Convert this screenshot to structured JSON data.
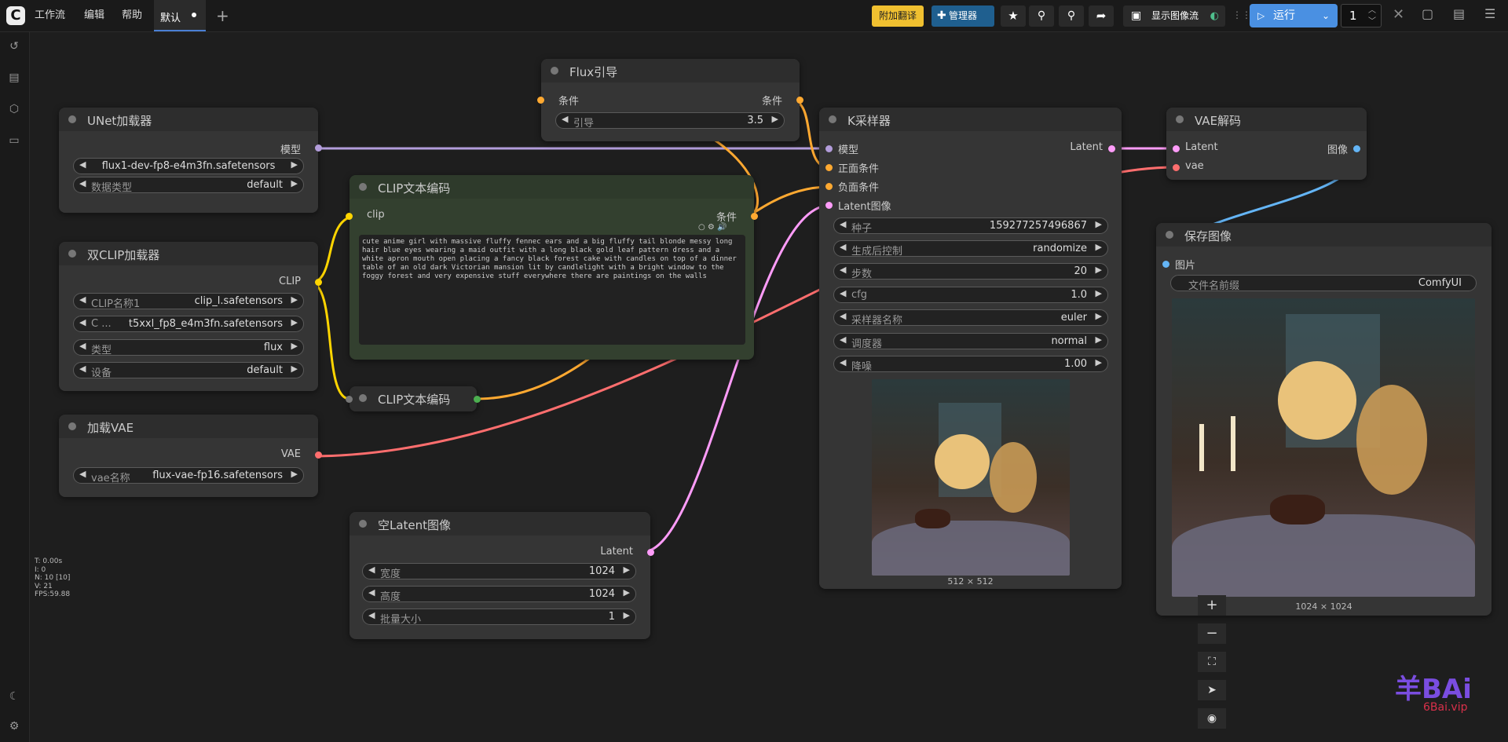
{
  "menu": {
    "workflow": "工作流",
    "edit": "编辑",
    "help": "帮助"
  },
  "tab": {
    "label": "默认"
  },
  "toolbar": {
    "translate": "附加翻译",
    "manager": "管理器",
    "show_flow": "显示图像流",
    "run": "运行",
    "queue_count": "1"
  },
  "nodes": {
    "unet": {
      "title": "UNet加载器",
      "out_model": "模型",
      "unet_name": "flux1-dev-fp8-e4m3fn.safetensors",
      "dtype_label": "数据类型",
      "dtype_value": "default"
    },
    "dualclip": {
      "title": "双CLIP加载器",
      "out_clip": "CLIP",
      "clip1_label": "CLIP名称1",
      "clip1_value": "clip_l.safetensors",
      "clip2_label": "C ...",
      "clip2_value": "t5xxl_fp8_e4m3fn.safetensors",
      "type_label": "类型",
      "type_value": "flux",
      "device_label": "设备",
      "device_value": "default"
    },
    "vae_loader": {
      "title": "加载VAE",
      "out_vae": "VAE",
      "vae_label": "vae名称",
      "vae_value": "flux-vae-fp16.safetensors"
    },
    "clip_encode": {
      "title": "CLIP文本编码",
      "in_clip": "clip",
      "out_cond": "条件",
      "text": "cute anime girl with massive fluffy fennec ears and a big fluffy tail blonde messy long hair blue eyes wearing a maid outfit with a long black gold leaf pattern dress and a white apron mouth open placing a fancy black forest cake with candles on top of a dinner table of an old dark Victorian mansion lit by candlelight with a bright window to the foggy forest and very expensive stuff everywhere there are paintings on the walls"
    },
    "clip_encode2": {
      "title": "CLIP文本编码"
    },
    "flux_guidance": {
      "title": "Flux引导",
      "in_cond": "条件",
      "out_cond": "条件",
      "guidance_label": "引导",
      "guidance_value": "3.5"
    },
    "empty_latent": {
      "title": "空Latent图像",
      "out_latent": "Latent",
      "width_label": "宽度",
      "width_value": "1024",
      "height_label": "高度",
      "height_value": "1024",
      "batch_label": "批量大小",
      "batch_value": "1"
    },
    "ksampler": {
      "title": "K采样器",
      "in_model": "模型",
      "in_pos": "正面条件",
      "in_neg": "负面条件",
      "in_latent": "Latent图像",
      "out_latent": "Latent",
      "seed_label": "种子",
      "seed_value": "159277257496867",
      "control_label": "生成后控制",
      "control_value": "randomize",
      "steps_label": "步数",
      "steps_value": "20",
      "cfg_label": "cfg",
      "cfg_value": "1.0",
      "sampler_label": "采样器名称",
      "sampler_value": "euler",
      "scheduler_label": "调度器",
      "scheduler_value": "normal",
      "denoise_label": "降噪",
      "denoise_value": "1.00",
      "preview_size": "512 × 512"
    },
    "vae_decode": {
      "title": "VAE解码",
      "in_latent": "Latent",
      "in_vae": "vae",
      "out_image": "图像"
    },
    "save_image": {
      "title": "保存图像",
      "in_images": "图片",
      "prefix_label": "文件名前缀",
      "prefix_value": "ComfyUI",
      "image_size": "1024 × 1024"
    }
  },
  "stats": {
    "t": "T: 0.00s",
    "i": "I: 0",
    "n": "N: 10 [10]",
    "v": "V: 21",
    "fps": "FPS:59.88"
  },
  "watermark": {
    "brand": "羊BAi",
    "url": "6Bai.vip"
  },
  "colors": {
    "model": "#b39ddb",
    "clip": "#ffd500",
    "cond": "#ffa931",
    "vae": "#ff6e6e",
    "latent": "#ff9cf9",
    "image": "#64b5f6",
    "run": "#4a90e2",
    "translate": "#f0c030",
    "manager": "#1f5f8f"
  }
}
